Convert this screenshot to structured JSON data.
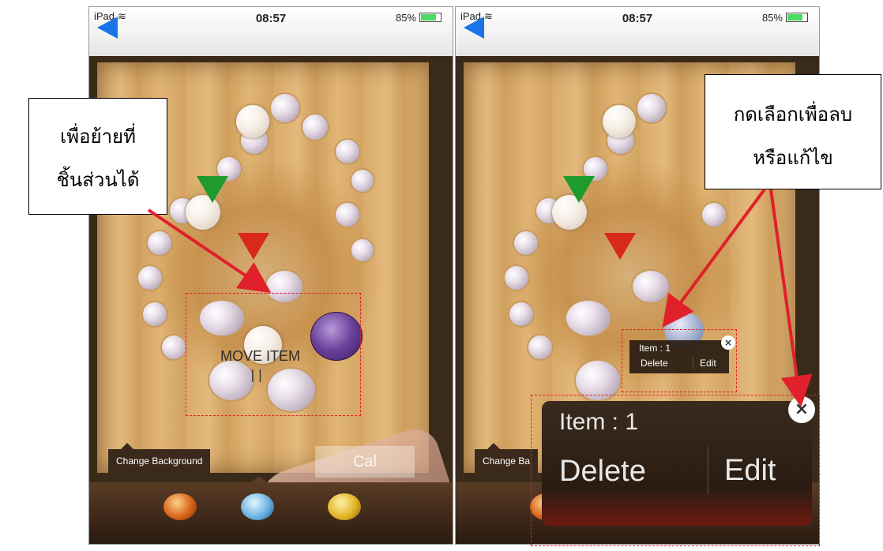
{
  "status_bar": {
    "carrier": "iPad",
    "time": "08:57",
    "battery": "85%"
  },
  "left_screen": {
    "move_label": "MOVE ITEM",
    "move_hint": "||",
    "tooltip": "Change Background",
    "calc_button": "Cal",
    "callout_line1": "เพื่อย้ายที่",
    "callout_line2": "ชิ้นส่วนได้"
  },
  "right_screen": {
    "item_label": "Item : 1",
    "delete_label": "Delete",
    "edit_label": "Edit",
    "tooltip": "Change Ba",
    "zoom_item_label": "Item : 1",
    "zoom_delete_label": "Delete",
    "zoom_edit_label": "Edit",
    "callout_line1": "กดเลือกเพื่อลบ",
    "callout_line2": "หรือแก้ไข"
  },
  "colors": {
    "annotation_red": "#e0202a",
    "back_arrow": "#1a73e8",
    "popup_bg": "#281c12"
  },
  "icons": [
    "back-arrow-icon",
    "wifi-icon",
    "battery-icon",
    "close-icon"
  ]
}
